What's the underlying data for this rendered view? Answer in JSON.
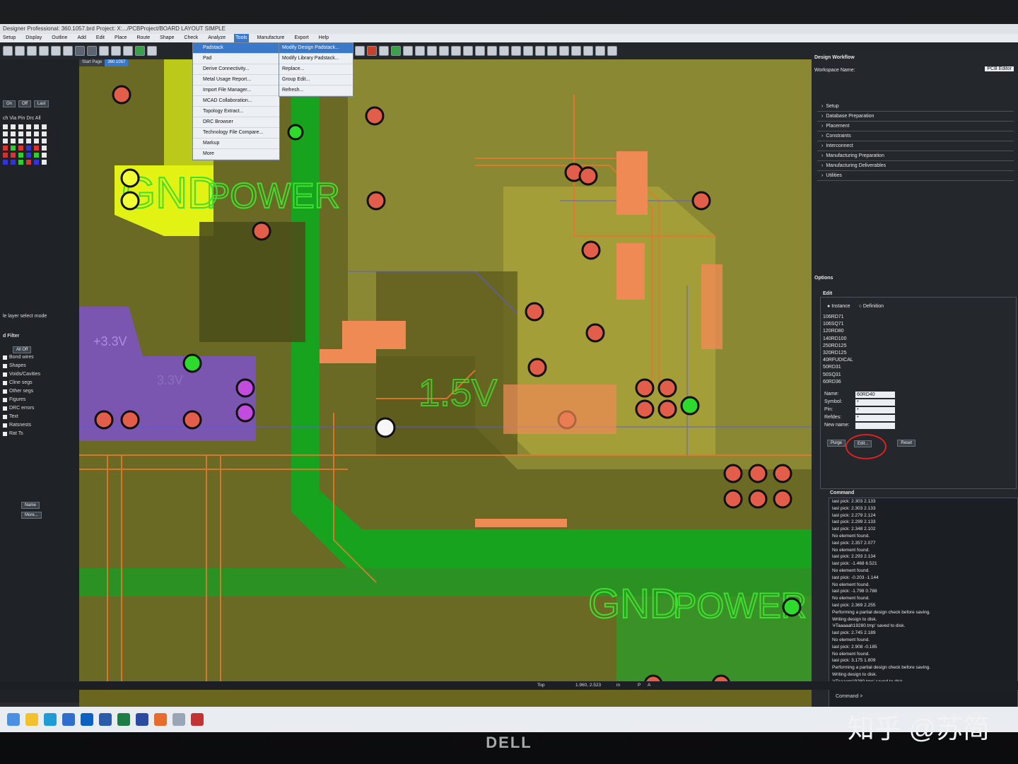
{
  "titlebar": {
    "text": "Designer Professional: 360.1057.brd  Project: X:.../PCBProject/BOARD LAYOUT SIMPLE"
  },
  "menu": {
    "items": [
      "Setup",
      "Display",
      "Outline",
      "Add",
      "Edit",
      "Place",
      "Route",
      "Shape",
      "Check",
      "Analyze",
      "Tools",
      "Manufacture",
      "Export",
      "Help"
    ],
    "active": "Tools"
  },
  "tabs": [
    "Start Page",
    "360.1057"
  ],
  "tools_menu": {
    "items": [
      "Padstack",
      "Pad",
      "Derive Connectivity...",
      "Metal Usage Report...",
      "Import File Manager...",
      "MCAD Collaboration...",
      "Topology Extract...",
      "DRC Browser",
      "Technology File Compare...",
      "Markup",
      "More"
    ],
    "selected": "Padstack"
  },
  "padstack_submenu": {
    "items": [
      "Modify Design Padstack...",
      "Modify Library Padstack...",
      "Replace...",
      "Group Edit...",
      "Refresh..."
    ],
    "selected": "Modify Design Padstack..."
  },
  "left_panel": {
    "buttons": [
      "On",
      "Off",
      "Last"
    ],
    "columns_header": "ch Via Pin Drc All",
    "mode_label": "le layer select mode",
    "filter_title": "d Filter",
    "filter_alloff": "All Off",
    "filter_items": [
      "Bond wires",
      "Shapes",
      "Voids/Cavities",
      "Cline segs",
      "Other segs",
      "Figures",
      "DRC errors",
      "Text",
      "Ratsnests",
      "Rat Ts"
    ],
    "name_dropdown": "Name",
    "more_button": "More..."
  },
  "board": {
    "labels": [
      "GND",
      "POWER",
      "GND",
      "POWER",
      "+3.3V",
      "3.3V",
      "1.5V"
    ]
  },
  "right_panel": {
    "workflow_title": "Design Workflow",
    "workspace_label": "Workspace Name:",
    "workspace_value": "PCB Editor",
    "workflow_items": [
      "Setup",
      "Database Preparation",
      "Placement",
      "Constraints",
      "Interconnect",
      "Manufacturing Preparation",
      "Manufacturing Deliverables",
      "Utilities"
    ],
    "options_title": "Options",
    "edit_label": "Edit",
    "instance_label": "Instance",
    "definition_label": "Definition",
    "padstacks": [
      "106RD71",
      "106SQ71",
      "120RD80",
      "140RD100",
      "250RD125",
      "320RD125",
      "40RFUDICAL",
      "50RD31",
      "50SQ31",
      "60RD36"
    ],
    "fields": [
      {
        "label": "Name:",
        "value": "60RD40"
      },
      {
        "label": "Symbol:",
        "value": "*"
      },
      {
        "label": "Pin:",
        "value": "*"
      },
      {
        "label": "Refdes:",
        "value": "*"
      },
      {
        "label": "New name:",
        "value": ""
      }
    ],
    "purge_button": "Purge",
    "edit_button": "Edit...",
    "reset_button": "Reset",
    "command_title": "Command",
    "command_log": [
      "last pick: 2.303 2.133",
      "last pick: 2.303 2.133",
      "last pick: 2.279 2.124",
      "last pick: 2.299 2.133",
      "last pick: 2.348 2.102",
      "No element found.",
      "last pick: 2.357 2.077",
      "No element found.",
      "last pick: 2.293 2.134",
      "last pick: -1.468 6.521",
      "No element found.",
      "last pick: -0.203 -1.144",
      "No element found.",
      "last pick: -1.798 0.788",
      "No element found.",
      "last pick: 2.369 2.255",
      "Performing a partial design check before saving.",
      "Writing design to disk.",
      "'#Taaaaah19280.tmp' saved to disk.",
      "last pick: 2.745 2.189",
      "No element found.",
      "last pick: 2.908 -0.185",
      "No element found.",
      "last pick: 3.175 1.809",
      "Performing a partial design check before saving.",
      "Writing design to disk.",
      "'#Taaaam19280.tmp' saved to disk."
    ],
    "command_prompt": "Command >"
  },
  "status": {
    "layer": "Top",
    "coords": "1.960, 2.523",
    "units": "in",
    "p": "P",
    "a": "A"
  },
  "monitor_brand": "DELL",
  "watermark": "知乎 @苏简",
  "colors": {
    "menu_accent": "#3a78c9",
    "board_base": "#6a6620",
    "gnd_green": "#18a31f",
    "pad_orange": "#e06a3b",
    "highlight": "#e2f313",
    "purple": "#7c52c9"
  }
}
